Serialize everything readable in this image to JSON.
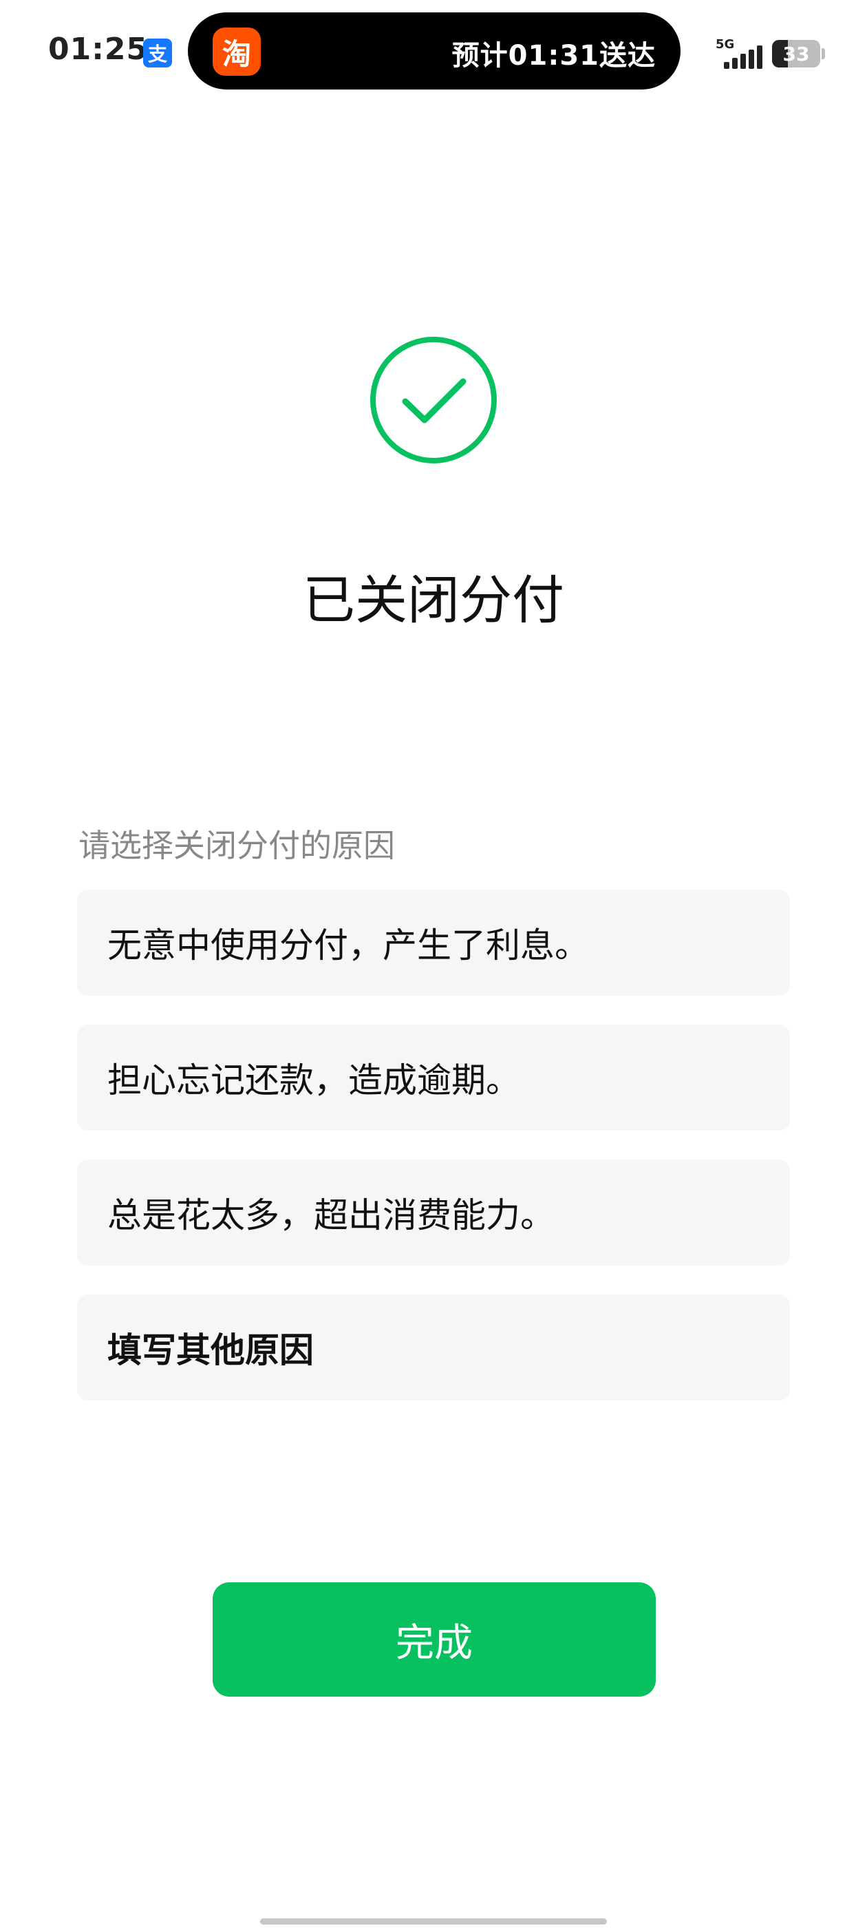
{
  "status_bar": {
    "time": "01:25",
    "alipay_icon": "支",
    "island": {
      "app_icon": "淘",
      "text": "预计01:31送达"
    },
    "network": "5G",
    "battery_level": "33"
  },
  "main": {
    "title": "已关闭分付",
    "prompt": "请选择关闭分付的原因",
    "reasons": [
      "无意中使用分付，产生了利息。",
      "担心忘记还款，造成逾期。",
      "总是花太多，超出消费能力。",
      "填写其他原因"
    ],
    "done_label": "完成"
  },
  "colors": {
    "accent": "#07c160",
    "item_bg": "#f6f6f6",
    "prompt_text": "#888888"
  }
}
